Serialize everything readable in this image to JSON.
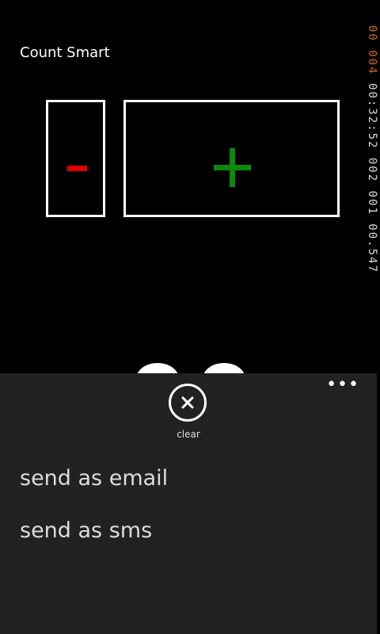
{
  "app": {
    "title": "Count Smart"
  },
  "counter": {
    "minus_icon": "minus-icon",
    "plus_icon": "plus-icon",
    "minus_color": "#e00000",
    "plus_color": "#0a8a0a"
  },
  "side_display": {
    "orange_text": "00 004",
    "white_text": "00:32:52 002 001 00.547"
  },
  "appbar": {
    "more_icon": "more-icon",
    "clear_label": "clear",
    "menu_items": [
      "send as email",
      "send as sms"
    ]
  }
}
